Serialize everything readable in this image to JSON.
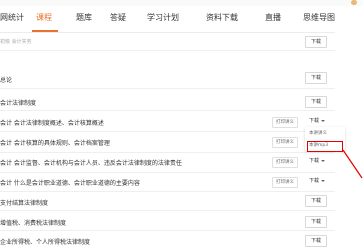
{
  "nav": {
    "items": [
      {
        "label": "网统计",
        "active": false
      },
      {
        "label": "课程",
        "active": true
      },
      {
        "label": "题库",
        "active": false
      },
      {
        "label": "答疑",
        "active": false
      },
      {
        "label": "学习计划",
        "active": false
      },
      {
        "label": "资料下载",
        "active": false
      },
      {
        "label": "直播",
        "active": false
      },
      {
        "label": "思维导图",
        "active": false
      }
    ]
  },
  "breadcrumb": "初级 会计实务",
  "download_label": "下载",
  "print_label": "打印讲义",
  "rows": [
    {
      "text": "",
      "download": "下载"
    },
    {
      "text": "总论",
      "download": "下载"
    },
    {
      "text": "会计法律制度",
      "download": "下载"
    },
    {
      "text": "会计   会计法律制度概述、会计核算概述",
      "print": "打印讲义",
      "download": "下载"
    },
    {
      "text": "会计   会计核算的具体规则、会计档案管理",
      "print": "打印讲义",
      "download": "下载"
    },
    {
      "text": "会计   会计监督、会计机构与会计人员、违反会计法律制度的法律责任",
      "print": "打印讲义",
      "download": "下载"
    },
    {
      "text": "会计   什么是会计职业道德、会计职业道德的主要内容",
      "print": "打印讲义",
      "download": "下载"
    },
    {
      "text": "支付结算法律制度",
      "download": "下载"
    },
    {
      "text": "增值税、消费税法律制度",
      "download": "下载"
    },
    {
      "text": "企业所得税、个人所得税法律制度",
      "download": "下载"
    }
  ],
  "dropdown": {
    "items": [
      "本讲讲义",
      "本讲mp3"
    ]
  },
  "colors": {
    "accent": "#e8732e",
    "highlight": "#e60000"
  }
}
